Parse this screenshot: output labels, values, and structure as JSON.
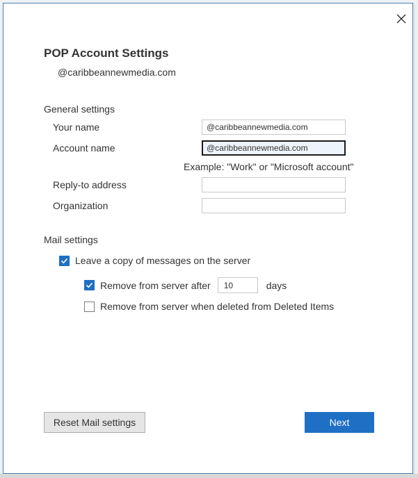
{
  "dialog": {
    "title": "POP Account Settings",
    "account_email": "@caribbeannewmedia.com",
    "close_icon": "close-x-icon"
  },
  "general": {
    "heading": "General settings",
    "your_name": {
      "label": "Your name",
      "value": "@caribbeannewmedia.com"
    },
    "account_name": {
      "label": "Account name",
      "value": "@caribbeannewmedia.com"
    },
    "example_hint": "Example: \"Work\" or \"Microsoft account\"",
    "reply_to": {
      "label": "Reply-to address",
      "value": ""
    },
    "organization": {
      "label": "Organization",
      "value": ""
    }
  },
  "mail": {
    "heading": "Mail settings",
    "leave_copy": {
      "label": "Leave a copy of messages on the server",
      "checked": true
    },
    "remove_after": {
      "label": "Remove from server after",
      "checked": true,
      "days_value": "10",
      "days_unit": "days"
    },
    "remove_deleted": {
      "label": "Remove from server when deleted from Deleted Items",
      "checked": false
    }
  },
  "buttons": {
    "reset": "Reset Mail settings",
    "next": "Next"
  },
  "colors": {
    "accent": "#1f6fc5",
    "dialog_border": "#4a7fb0"
  }
}
